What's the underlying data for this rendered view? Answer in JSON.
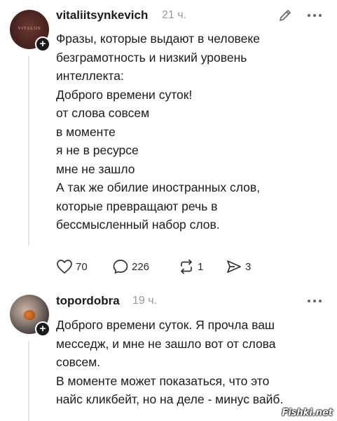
{
  "comment1": {
    "avatar_text": "VITALIIS",
    "username": "vitaliitsynkevich",
    "time": "21 ч.",
    "lines": [
      "Фразы, которые выдают в человеке",
      "безграмотность и низкий уровень",
      "интеллекта:",
      "Доброго времени суток!",
      "от слова совсем",
      "в моменте",
      "я не в ресурсе",
      "мне не зашло",
      "А так же обилие иностранных слов,",
      "которые превращают речь в",
      "бессмысленный набор слов."
    ],
    "actions": {
      "likes": "70",
      "comments": "226",
      "reposts": "1",
      "shares": "3"
    }
  },
  "comment2": {
    "username": "topordobra",
    "time": "19 ч.",
    "lines": [
      "Доброго времени суток. Я прочла ваш",
      "месседж, и мне не зашло вот от слова",
      "совсем.",
      "В моменте может показаться, что это",
      "найс кликбейт, но на деле - минус вайб."
    ]
  },
  "watermark": "Fishki.net"
}
